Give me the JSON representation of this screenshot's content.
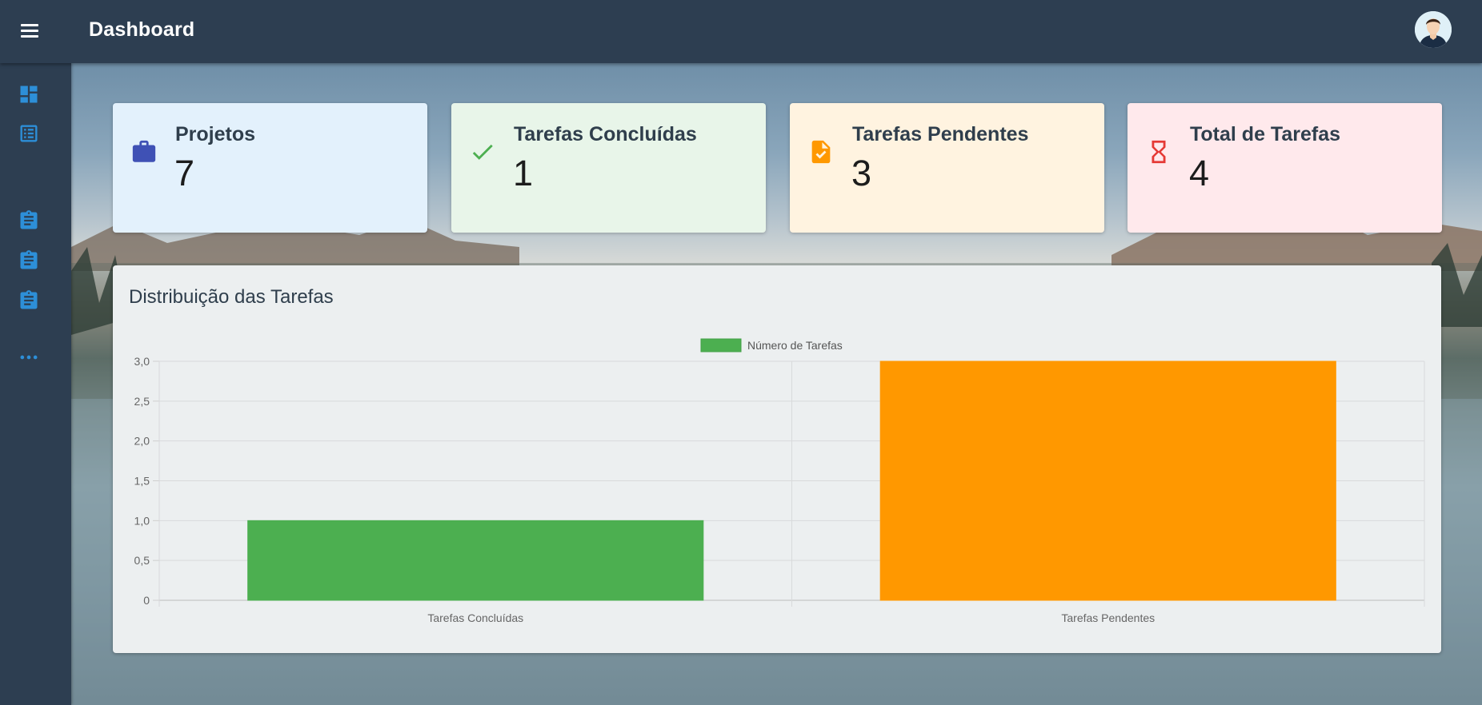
{
  "appbar": {
    "title": "Dashboard"
  },
  "sidebar": {
    "items": [
      {
        "icon": "dashboard-icon"
      },
      {
        "icon": "list-icon"
      },
      {
        "icon": "clipboard-icon"
      },
      {
        "icon": "clipboard-icon"
      },
      {
        "icon": "clipboard-icon"
      },
      {
        "icon": "more-horizontal-icon"
      }
    ],
    "accent": "#2d8fd8"
  },
  "cards": [
    {
      "label": "Projetos",
      "value": "7",
      "icon": "briefcase-icon",
      "bg": "#e3f1fc",
      "icon_color": "#3f51b5"
    },
    {
      "label": "Tarefas Concluídas",
      "value": "1",
      "icon": "check-icon",
      "bg": "#e8f5e9",
      "icon_color": "#4caf50"
    },
    {
      "label": "Tarefas Pendentes",
      "value": "3",
      "icon": "task-file-icon",
      "bg": "#fff3e0",
      "icon_color": "#ff9800"
    },
    {
      "label": "Total de Tarefas",
      "value": "4",
      "icon": "hourglass-icon",
      "bg": "#ffe9ec",
      "icon_color": "#e53935"
    }
  ],
  "panel": {
    "title": "Distribuição das Tarefas"
  },
  "chart_data": {
    "type": "bar",
    "categories": [
      "Tarefas Concluídas",
      "Tarefas Pendentes"
    ],
    "series": [
      {
        "name": "Número de Tarefas",
        "values": [
          1,
          3
        ],
        "colors": [
          "#4caf50",
          "#ff9800"
        ]
      }
    ],
    "ylim": [
      0,
      3
    ],
    "yticks": [
      "0",
      "0,5",
      "1,0",
      "1,5",
      "2,0",
      "2,5",
      "3,0"
    ],
    "legend": "top-center",
    "grid": true
  }
}
